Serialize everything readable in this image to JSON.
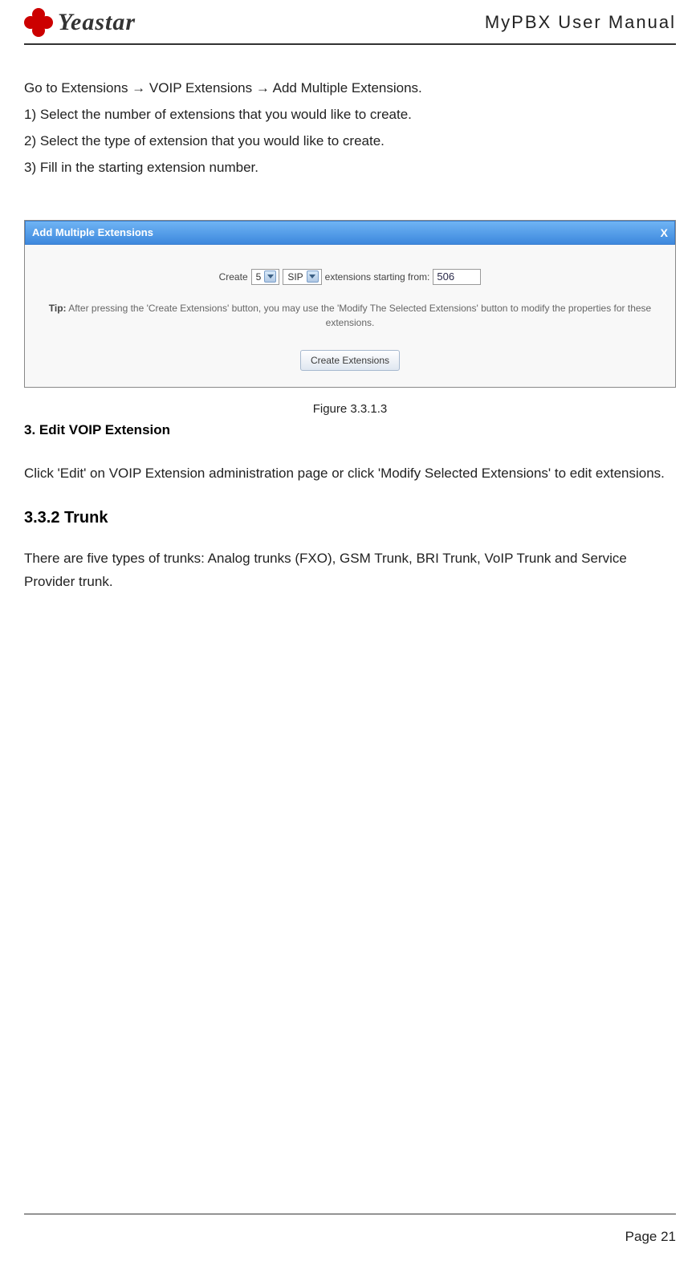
{
  "header": {
    "brand": "Yeastar",
    "doc_title": "MyPBX User Manual"
  },
  "intro": {
    "nav_line": "Go to Extensions → VOIP Extensions → Add Multiple Extensions.",
    "step1": "1) Select the number of extensions that you would like to create.",
    "step2": "2) Select the type of extension that you would like to create.",
    "step3": "3) Fill in the starting extension number."
  },
  "dialog": {
    "title": "Add Multiple Extensions",
    "close": "X",
    "create_label": "Create",
    "count_value": "5",
    "type_value": "SIP",
    "mid_text": "extensions starting from:",
    "start_value": "506",
    "tip_label": "Tip:",
    "tip_text": " After pressing the 'Create Extensions' button, you may use the 'Modify The Selected Extensions' button to modify the properties for these extensions.",
    "button_label": "Create Extensions"
  },
  "caption": "Figure 3.3.1.3",
  "edit_section": {
    "heading": "3. Edit VOIP Extension",
    "para": "Click 'Edit' on VOIP Extension administration page or click 'Modify Selected Extensions' to edit extensions."
  },
  "trunk_section": {
    "heading": "3.3.2 Trunk",
    "para": "There are five types of trunks: Analog trunks (FXO), GSM Trunk, BRI Trunk, VoIP Trunk and Service Provider trunk."
  },
  "footer": {
    "page": "Page 21"
  }
}
